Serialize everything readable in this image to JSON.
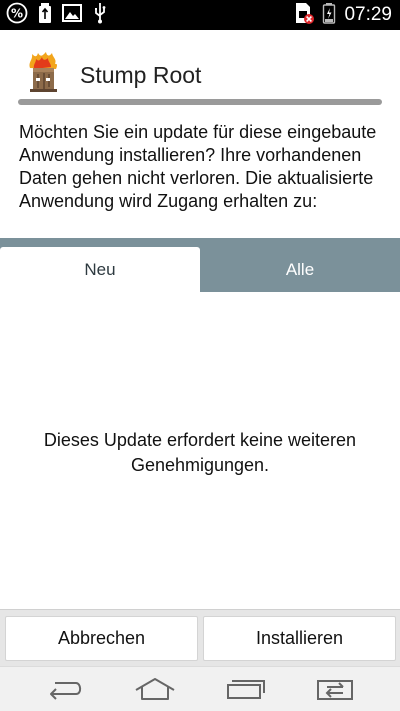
{
  "status_bar": {
    "time": "07:29",
    "icons": [
      "percent-badge-icon",
      "battery-usb-icon",
      "image-icon",
      "usb-icon",
      "no-sim-icon",
      "battery-charging-icon"
    ]
  },
  "app": {
    "title": "Stump Root",
    "icon": "burning-tree-stump-icon"
  },
  "description": "Möchten Sie ein update für diese eingebaute Anwendung installieren? Ihre vorhandenen Daten gehen nicht verloren. Die aktualisierte Anwendung wird Zugang erhalten zu:",
  "tabs": [
    {
      "label": "Neu",
      "selected": true
    },
    {
      "label": "Alle",
      "selected": false
    }
  ],
  "content": {
    "message": "Dieses Update erfordert keine weiteren Genehmigungen."
  },
  "buttons": {
    "cancel": "Abbrechen",
    "install": "Installieren"
  },
  "nav": {
    "icons": [
      "back-icon",
      "home-icon",
      "recents-icon",
      "switch-apps-icon"
    ]
  },
  "colors": {
    "tab_bar": "#7b919a",
    "status_bar": "#000000",
    "button_bar": "#e6e6e6"
  }
}
